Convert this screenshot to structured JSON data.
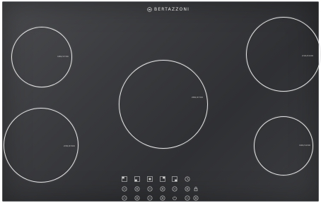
{
  "brand": {
    "name": "BERTAZZONI",
    "logo_icon": "crown-logo-icon"
  },
  "surface": {
    "glass_color": "#3a3b3e",
    "zone_ring_color": "#e6e6e6"
  },
  "zones": [
    {
      "id": "rear-left",
      "label": "180/1700"
    },
    {
      "id": "center",
      "label": "280/2700"
    },
    {
      "id": "rear-right",
      "label": "210/2100"
    },
    {
      "id": "front-left",
      "label": "230/2300"
    },
    {
      "id": "front-right",
      "label": "160/1200"
    }
  ],
  "controls": {
    "zone_selectors": [
      {
        "icon": "zone-rear-left-icon"
      },
      {
        "icon": "zone-front-left-icon"
      },
      {
        "icon": "zone-center-icon"
      },
      {
        "icon": "zone-rear-right-icon"
      },
      {
        "icon": "zone-front-right-icon"
      }
    ],
    "timer_icon": "timer-icon",
    "power_down_buttons": [
      "minus-icon",
      "minus-icon",
      "minus-icon",
      "minus-icon",
      "minus-icon"
    ],
    "power_up_buttons": [
      "plus-icon",
      "plus-icon",
      "plus-icon",
      "plus-icon",
      "plus-icon"
    ],
    "function_icons": [
      "lock-icon",
      "power-icon",
      "timer-minus-icon",
      "timer-plus-icon"
    ]
  }
}
